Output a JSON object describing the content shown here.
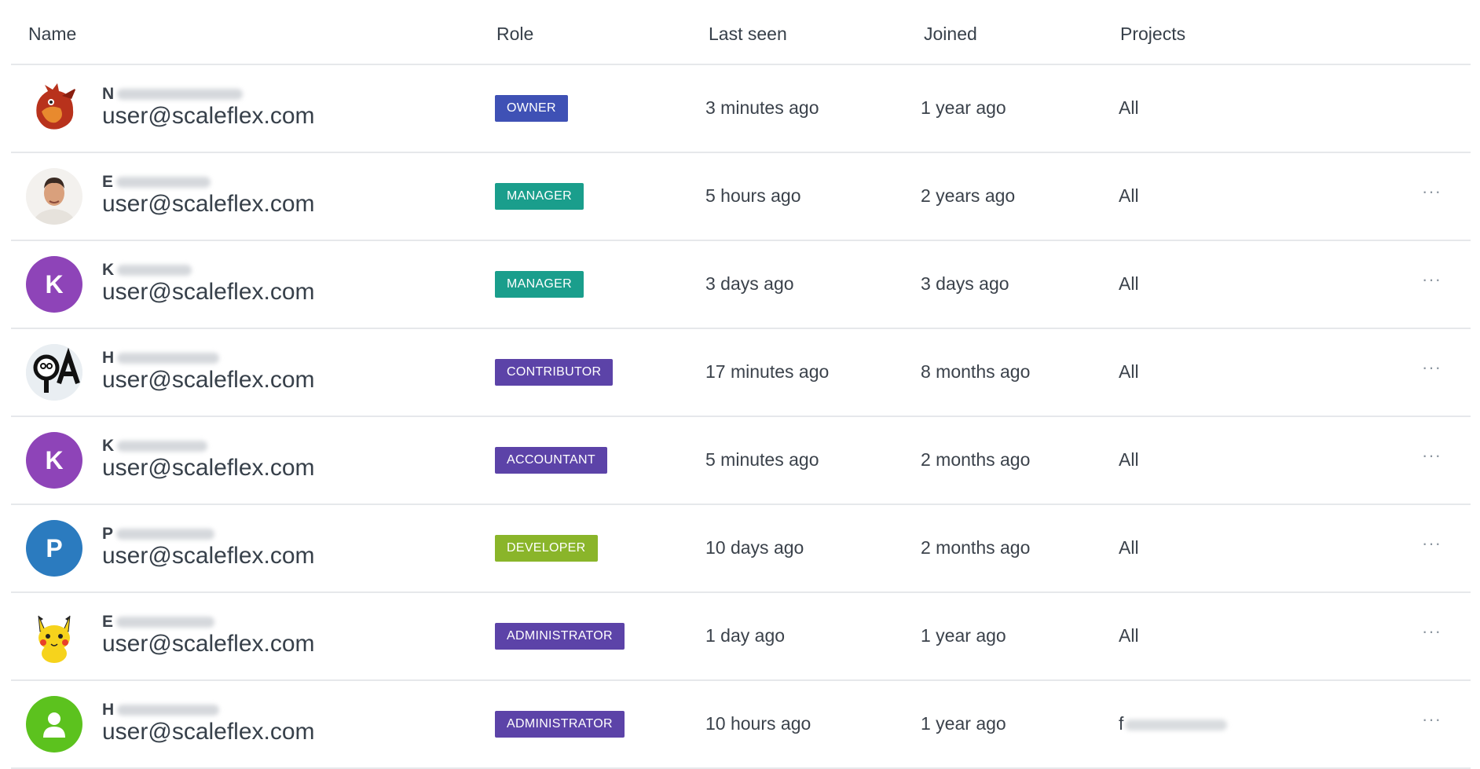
{
  "columns": {
    "name": "Name",
    "role": "Role",
    "last_seen": "Last seen",
    "joined": "Joined",
    "projects": "Projects"
  },
  "more_label": "···",
  "role_colors": {
    "OWNER": "#3f51b5",
    "MANAGER": "#1a9e8c",
    "CONTRIBUTOR": "#5c43a8",
    "ACCOUNTANT": "#5c43a8",
    "DEVELOPER": "#8ab52a",
    "ADMINISTRATOR": "#5c43a8"
  },
  "users": [
    {
      "name_initial": "N",
      "email": "user@scaleflex.com",
      "role": "OWNER",
      "last_seen": "3 minutes ago",
      "joined": "1 year ago",
      "projects": "All",
      "avatar_type": "dragon-image",
      "avatar_letter": "",
      "avatar_color": "#ffffff",
      "has_more": false
    },
    {
      "name_initial": "E",
      "email": "user@scaleflex.com",
      "role": "MANAGER",
      "last_seen": "5 hours ago",
      "joined": "2 years ago",
      "projects": "All",
      "avatar_type": "portrait-photo",
      "avatar_letter": "",
      "avatar_color": "#ffffff",
      "has_more": true
    },
    {
      "name_initial": "K",
      "email": "user@scaleflex.com",
      "role": "MANAGER",
      "last_seen": "3 days ago",
      "joined": "3 days ago",
      "projects": "All",
      "avatar_type": "letter",
      "avatar_letter": "K",
      "avatar_color": "#8e44b8",
      "has_more": true
    },
    {
      "name_initial": "H",
      "email": "user@scaleflex.com",
      "role": "CONTRIBUTOR",
      "last_seen": "17 minutes ago",
      "joined": "8 months ago",
      "projects": "All",
      "avatar_type": "qa-logo",
      "avatar_letter": "",
      "avatar_color": "#eef1f3",
      "has_more": true
    },
    {
      "name_initial": "K",
      "email": "user@scaleflex.com",
      "role": "ACCOUNTANT",
      "last_seen": "5 minutes ago",
      "joined": "2 months ago",
      "projects": "All",
      "avatar_type": "letter",
      "avatar_letter": "K",
      "avatar_color": "#8e44b8",
      "has_more": true
    },
    {
      "name_initial": "P",
      "email": "user@scaleflex.com",
      "role": "DEVELOPER",
      "last_seen": "10 days ago",
      "joined": "2 months ago",
      "projects": "All",
      "avatar_type": "letter",
      "avatar_letter": "P",
      "avatar_color": "#2b7bbf",
      "has_more": true
    },
    {
      "name_initial": "E",
      "email": "user@scaleflex.com",
      "role": "ADMINISTRATOR",
      "last_seen": "1 day ago",
      "joined": "1 year ago",
      "projects": "All",
      "avatar_type": "pikachu-image",
      "avatar_letter": "",
      "avatar_color": "#ffffff",
      "has_more": true
    },
    {
      "name_initial": "H",
      "email": "user@scaleflex.com",
      "role": "ADMINISTRATOR",
      "last_seen": "10 hours ago",
      "joined": "1 year ago",
      "projects": "f",
      "avatar_type": "user-icon",
      "avatar_letter": "",
      "avatar_color": "#5cc21e",
      "has_more": true
    }
  ]
}
